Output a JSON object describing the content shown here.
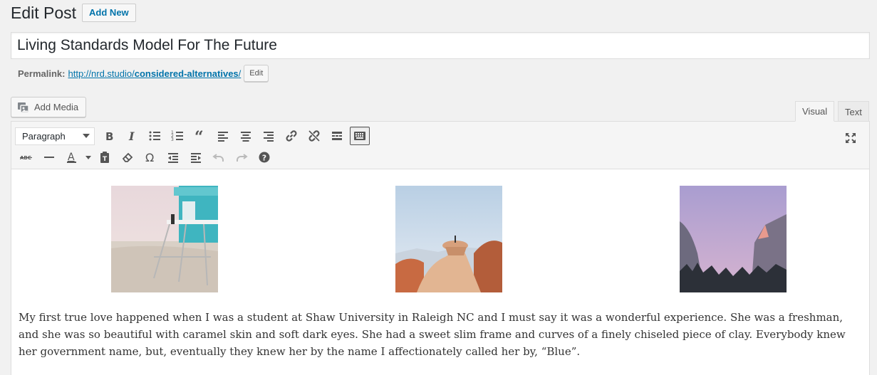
{
  "header": {
    "title": "Edit Post",
    "add_new": "Add New"
  },
  "post": {
    "title": "Living Standards Model For The Future"
  },
  "permalink": {
    "label": "Permalink:",
    "url_base": "http://nrd.studio/",
    "url_slug": "considered-alternatives",
    "url_trail": "/",
    "edit": "Edit"
  },
  "media": {
    "add_media": "Add Media"
  },
  "tabs": {
    "visual": "Visual",
    "text": "Text"
  },
  "toolbar": {
    "format": "Paragraph",
    "row1": [
      "bold-icon",
      "italic-icon",
      "bullet-list-icon",
      "numbered-list-icon",
      "blockquote-icon",
      "align-left-icon",
      "align-center-icon",
      "align-right-icon",
      "link-icon",
      "unlink-icon",
      "read-more-icon",
      "toolbar-toggle-icon"
    ],
    "row2": [
      "strikethrough-icon",
      "horizontal-line-icon",
      "text-color-icon",
      "paste-text-icon",
      "clear-formatting-icon",
      "special-character-icon",
      "outdent-icon",
      "indent-icon",
      "undo-icon",
      "redo-icon",
      "help-icon"
    ]
  },
  "content": {
    "paragraph": "My first true love happened when I was a student at Shaw University in Raleigh NC and I must say it was a wonderful experience. She was a freshman, and she was so beautiful with caramel skin and soft dark eyes. She had a sweet slim frame and curves of a finely chiseled piece of clay. Everybody knew her government name, but, eventually they knew her by the name I affectionately called her by, “Blue”."
  },
  "colors": {
    "link": "#0073aa",
    "background": "#f1f1f1"
  }
}
